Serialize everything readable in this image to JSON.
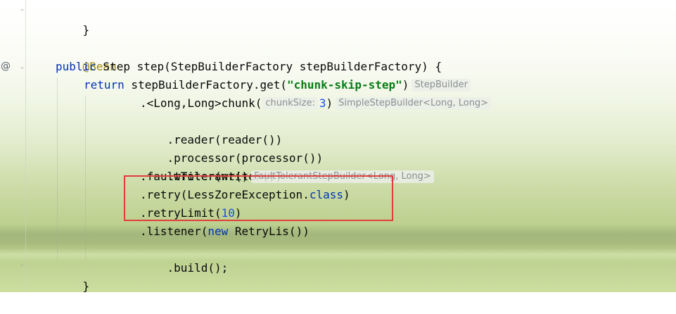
{
  "gutter": {
    "bean_marker": "@"
  },
  "code": {
    "line_close_brace_top": "}",
    "annotation": "@Bean",
    "signature": {
      "kw_public": "public",
      "rest": " Step step(StepBuilderFactory stepBuilderFactory) {"
    },
    "return_line": {
      "kw_return": "return",
      "call": " stepBuilderFactory.get(",
      "string": "\"chunk-skip-step\"",
      "close": ")",
      "type_hint": "StepBuilder"
    },
    "chunk_line": {
      "prefix": ".<Long,Long>chunk(",
      "param_hint": "chunkSize:",
      "value": "3",
      "close": ")",
      "type_hint": "SimpleStepBuilder<Long, Long>"
    },
    "reader_line": ".reader(reader())",
    "processor_line": ".processor(processor())",
    "writer_line": ".writer(writer())",
    "fault_line": {
      "text": ".faultTolerant()",
      "type_hint": "FaultTolerantStepBuilder<Long, Long>"
    },
    "retry_line": {
      "prefix": ".retry(LessZoreException.",
      "kw_class": "class",
      "close": ")"
    },
    "retry_limit_line": {
      "prefix": ".retryLimit(",
      "value": "10",
      "close": ")"
    },
    "listener_line": {
      "prefix": ".listener(",
      "kw_new": "new",
      "rest": " RetryLis())"
    },
    "build_line": ".build();",
    "line_close_brace_bottom": "}"
  },
  "colors": {
    "keyword": "#0033b3",
    "string": "#067d17",
    "annotation": "#9e880d",
    "number": "#1750eb",
    "highlight_box": "#e03d3d"
  }
}
